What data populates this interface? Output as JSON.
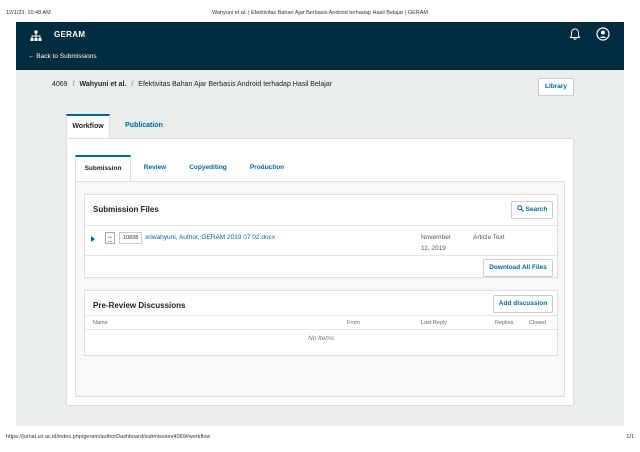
{
  "print": {
    "datetime": "12/1/23, 10:48 AM",
    "page_title": "Wahyuni et al. | Efektivitas Bahan Ajar Berbasis Android terhadap Hasil Belajar | GERAM",
    "url": "https://jurnal.uir.ac.id/index.php/geram/authorDashboard/submission/4069#workflow",
    "page_num": "1/1"
  },
  "header": {
    "site_name": "GERAM",
    "back_link": "← Back to Submissions"
  },
  "breadcrumb": {
    "id": "4069",
    "sep": "/",
    "authors": "Wahyuni et al.",
    "title": "Efektivitas Bahan Ajar Berbasis Android terhadap Hasil Belajar"
  },
  "library_label": "Library",
  "main_tabs": [
    "Workflow",
    "Publication"
  ],
  "sub_tabs": [
    "Submission",
    "Review",
    "Copyediting",
    "Production"
  ],
  "submission_files": {
    "title": "Submission Files",
    "search_label": "Search",
    "files": [
      {
        "id": "10838",
        "name": "sriwahyuni, Author, GERAM 2019 07 02.docx",
        "date": "November 11, 2019",
        "type": "Article Text"
      }
    ],
    "download_label": "Download All Files"
  },
  "discussions": {
    "title": "Pre-Review Discussions",
    "add_label": "Add discussion",
    "columns": [
      "Name",
      "From",
      "Last Reply",
      "Replies",
      "Closed"
    ],
    "empty": "No Items"
  }
}
